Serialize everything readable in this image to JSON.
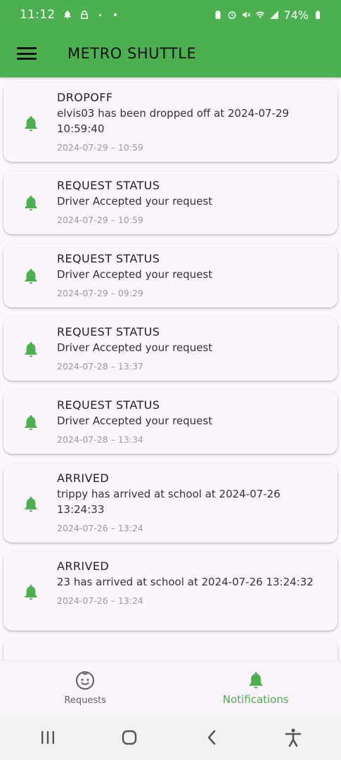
{
  "status_bar": {
    "time": "11:12",
    "battery": "74%"
  },
  "app_bar": {
    "title": "METRO SHUTTLE"
  },
  "notifications": [
    {
      "title": "DROPOFF",
      "body": "elvis03 has been dropped off at 2024-07-29 10:59:40",
      "time": "2024-07-29 – 10:59"
    },
    {
      "title": "REQUEST STATUS",
      "body": "Driver Accepted your request",
      "time": "2024-07-29 – 10:59"
    },
    {
      "title": "REQUEST STATUS",
      "body": "Driver Accepted your request",
      "time": "2024-07-29 – 09:29"
    },
    {
      "title": "REQUEST STATUS",
      "body": "Driver Accepted your request",
      "time": "2024-07-28 – 13:37"
    },
    {
      "title": "REQUEST STATUS",
      "body": "Driver Accepted your request",
      "time": "2024-07-28 – 13:34"
    },
    {
      "title": "ARRIVED",
      "body": "trippy has arrived at school at 2024-07-26 13:24:33",
      "time": "2024-07-26 – 13:24"
    },
    {
      "title": "ARRIVED",
      "body": "23 has arrived at school at 2024-07-26 13:24:32",
      "time": "2024-07-26 – 13:24"
    }
  ],
  "bottom_nav": {
    "requests_label": "Requests",
    "notifications_label": "Notifications",
    "active": "notifications"
  },
  "colors": {
    "primary": "#4caf50",
    "bell": "#4caf50",
    "inactive": "#666666"
  },
  "icons": {
    "menu": "hamburger-menu-icon",
    "notification": "bell-icon",
    "requests": "child-face-icon",
    "nav_recent": "recent-apps-icon",
    "nav_home": "home-icon",
    "nav_back": "back-icon",
    "nav_accessibility": "accessibility-icon"
  }
}
